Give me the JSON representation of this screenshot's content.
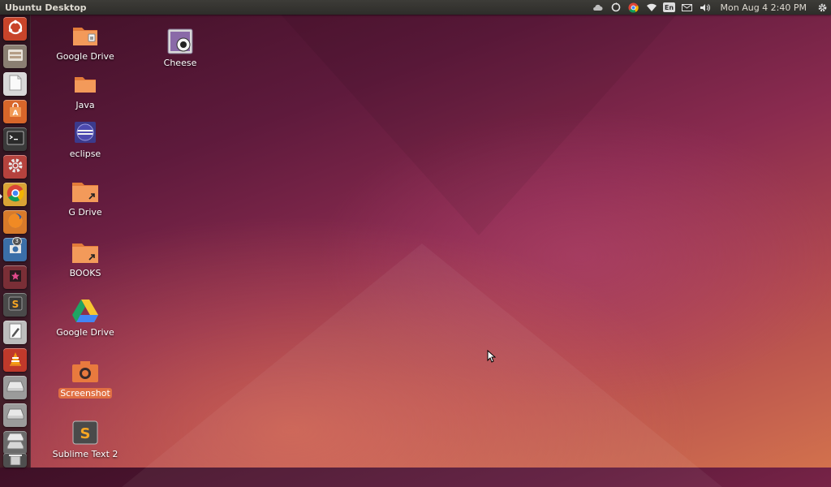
{
  "top_panel": {
    "title": "Ubuntu Desktop",
    "keyboard_layout": "En",
    "clock": "Mon Aug  4  2:40 PM"
  },
  "launcher": {
    "items": [
      {
        "name": "dash-home",
        "icon": "ubuntu-logo-icon",
        "bg": "#c8442a"
      },
      {
        "name": "files",
        "icon": "file-manager-icon",
        "bg": "#8a7f72"
      },
      {
        "name": "libreoffice",
        "icon": "document-icon",
        "bg": "#d8d8d8"
      },
      {
        "name": "software-center",
        "icon": "shopping-bag-icon",
        "bg": "#d8662a"
      },
      {
        "name": "terminal",
        "icon": "terminal-icon",
        "bg": "#3a3a3a"
      },
      {
        "name": "system-settings",
        "icon": "gear-icon",
        "bg": "#b5423d"
      },
      {
        "name": "chrome",
        "icon": "chrome-icon",
        "bg": "#d9a335"
      },
      {
        "name": "firefox",
        "icon": "firefox-icon",
        "bg": "#d87a2a"
      },
      {
        "name": "shutter",
        "icon": "camera-icon",
        "bg": "#3b6fa8",
        "badge": "3"
      },
      {
        "name": "rhythmbox",
        "icon": "music-icon",
        "bg": "#7a2e36"
      },
      {
        "name": "sublime-text",
        "icon": "sublime-icon",
        "bg": "#4a4a4a"
      },
      {
        "name": "text-editor",
        "icon": "pencil-icon",
        "bg": "#bdbdbd"
      },
      {
        "name": "vlc",
        "icon": "vlc-cone-icon",
        "bg": "#c0392b"
      },
      {
        "name": "drive-1",
        "icon": "drive-icon",
        "bg": "#9b9b9b"
      },
      {
        "name": "drive-2",
        "icon": "drive-icon",
        "bg": "#9b9b9b"
      },
      {
        "name": "trash",
        "icon": "trash-icon",
        "bg": "#6a6a6a"
      }
    ]
  },
  "desktop": {
    "icons": [
      {
        "label": "Google Drive",
        "icon": "folder-icon"
      },
      {
        "label": "Java",
        "icon": "folder-icon"
      },
      {
        "label": "eclipse",
        "icon": "eclipse-icon"
      },
      {
        "label": "G Drive",
        "icon": "folder-link-icon"
      },
      {
        "label": "BOOKS",
        "icon": "folder-link-icon"
      },
      {
        "label": "Google Drive",
        "icon": "google-drive-icon"
      },
      {
        "label": "Screenshot",
        "icon": "camera-icon",
        "selected": true
      },
      {
        "label": "Sublime Text 2",
        "icon": "sublime-icon"
      },
      {
        "label": "Cheese",
        "icon": "cheese-webcam-icon"
      }
    ]
  },
  "colors": {
    "accent": "#e06f43",
    "panel": "#2e2d2a",
    "folder": "#ef8a45"
  }
}
